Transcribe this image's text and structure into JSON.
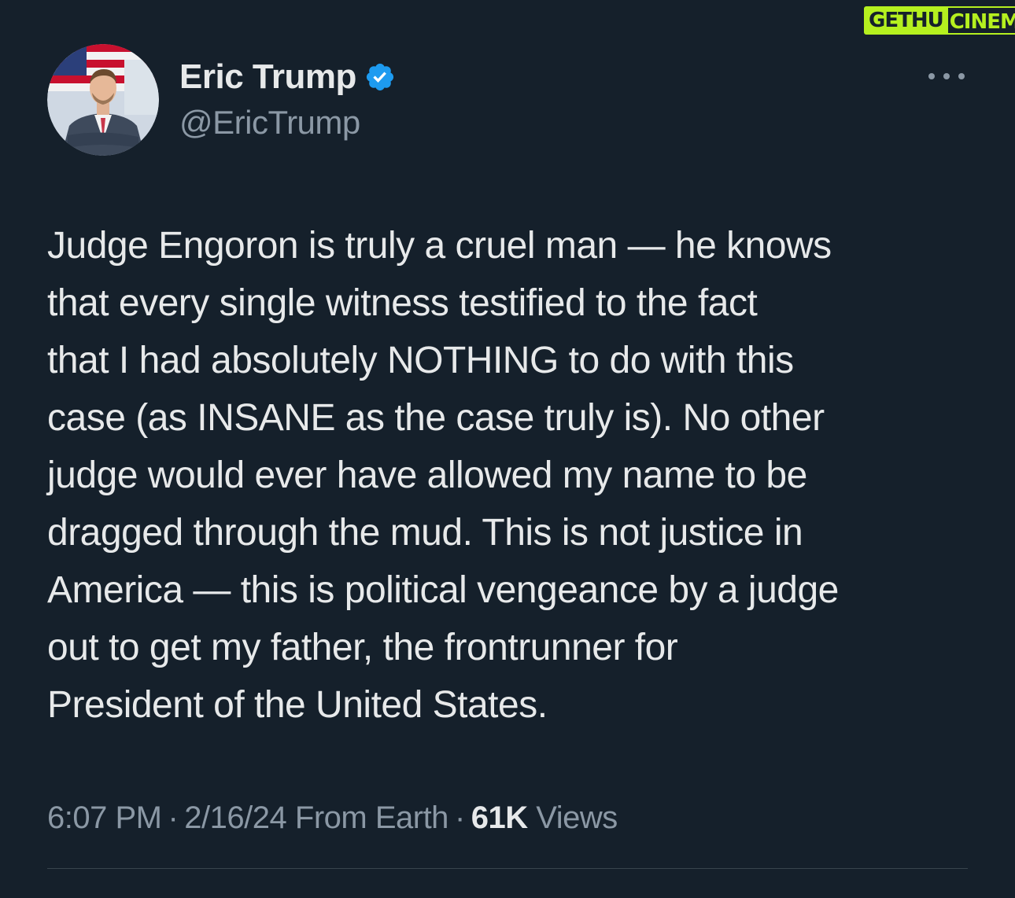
{
  "watermark": {
    "left": "GETHU",
    "right": "CINEMA"
  },
  "author": {
    "display_name": "Eric Trump",
    "handle": "@EricTrump",
    "avatar": "profile-photo",
    "verified_icon": "verified-badge-icon"
  },
  "tweet": {
    "lines": [
      "Judge Engoron is truly a cruel man — he knows",
      "that every single witness testified to the fact",
      "that I had absolutely NOTHING to do with this",
      "case (as INSANE as the case truly is). No other",
      "judge would ever have allowed my name to be",
      "dragged through the mud. This is not justice in",
      "America — this is political vengeance by a judge",
      "out to get my father, the frontrunner for",
      "President of the United States."
    ]
  },
  "meta": {
    "time": "6:07 PM",
    "separator": "·",
    "date": "2/16/24",
    "source": "From Earth",
    "views_count": "61K",
    "views_label": "Views"
  },
  "colors": {
    "background": "#15202b",
    "text": "#e7e9ea",
    "muted": "#8b98a5",
    "verified": "#1d9bf0",
    "divider": "#38444d",
    "watermark": "#b5f01f"
  },
  "icons": {
    "more": "more-options-icon"
  }
}
